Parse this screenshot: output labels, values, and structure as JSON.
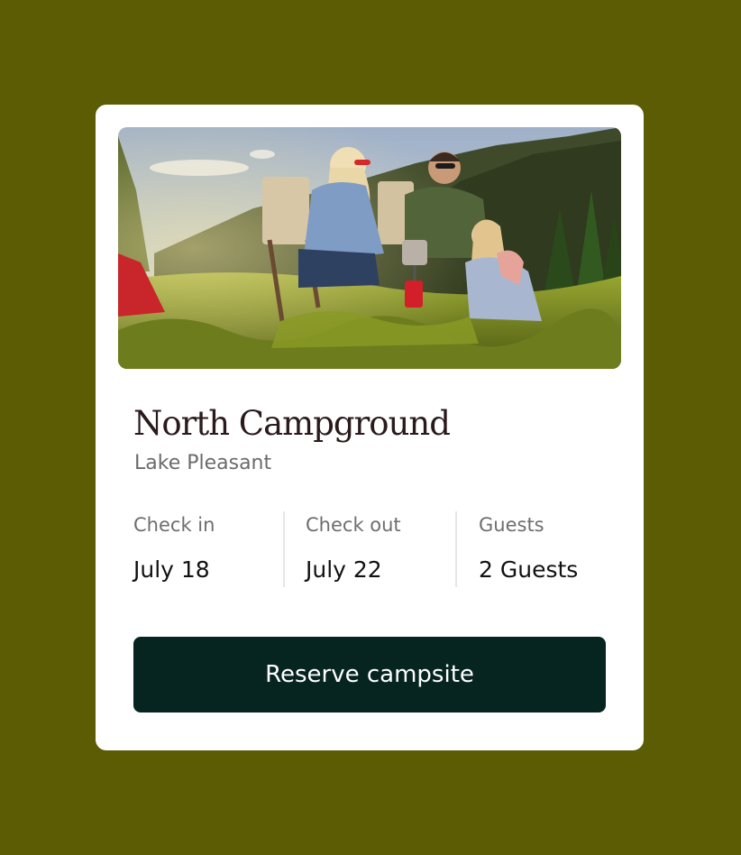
{
  "campsite": {
    "name": "North Campground",
    "location": "Lake Pleasant"
  },
  "details": [
    {
      "label": "Check in",
      "value": "July 18"
    },
    {
      "label": "Check out",
      "value": "July 22"
    },
    {
      "label": "Guests",
      "value": "2 Guests"
    }
  ],
  "actions": {
    "reserve_label": "Reserve campsite"
  },
  "colors": {
    "background": "#5b5c04",
    "card": "#ffffff",
    "button": "#062520",
    "title": "#2a1a1c"
  }
}
